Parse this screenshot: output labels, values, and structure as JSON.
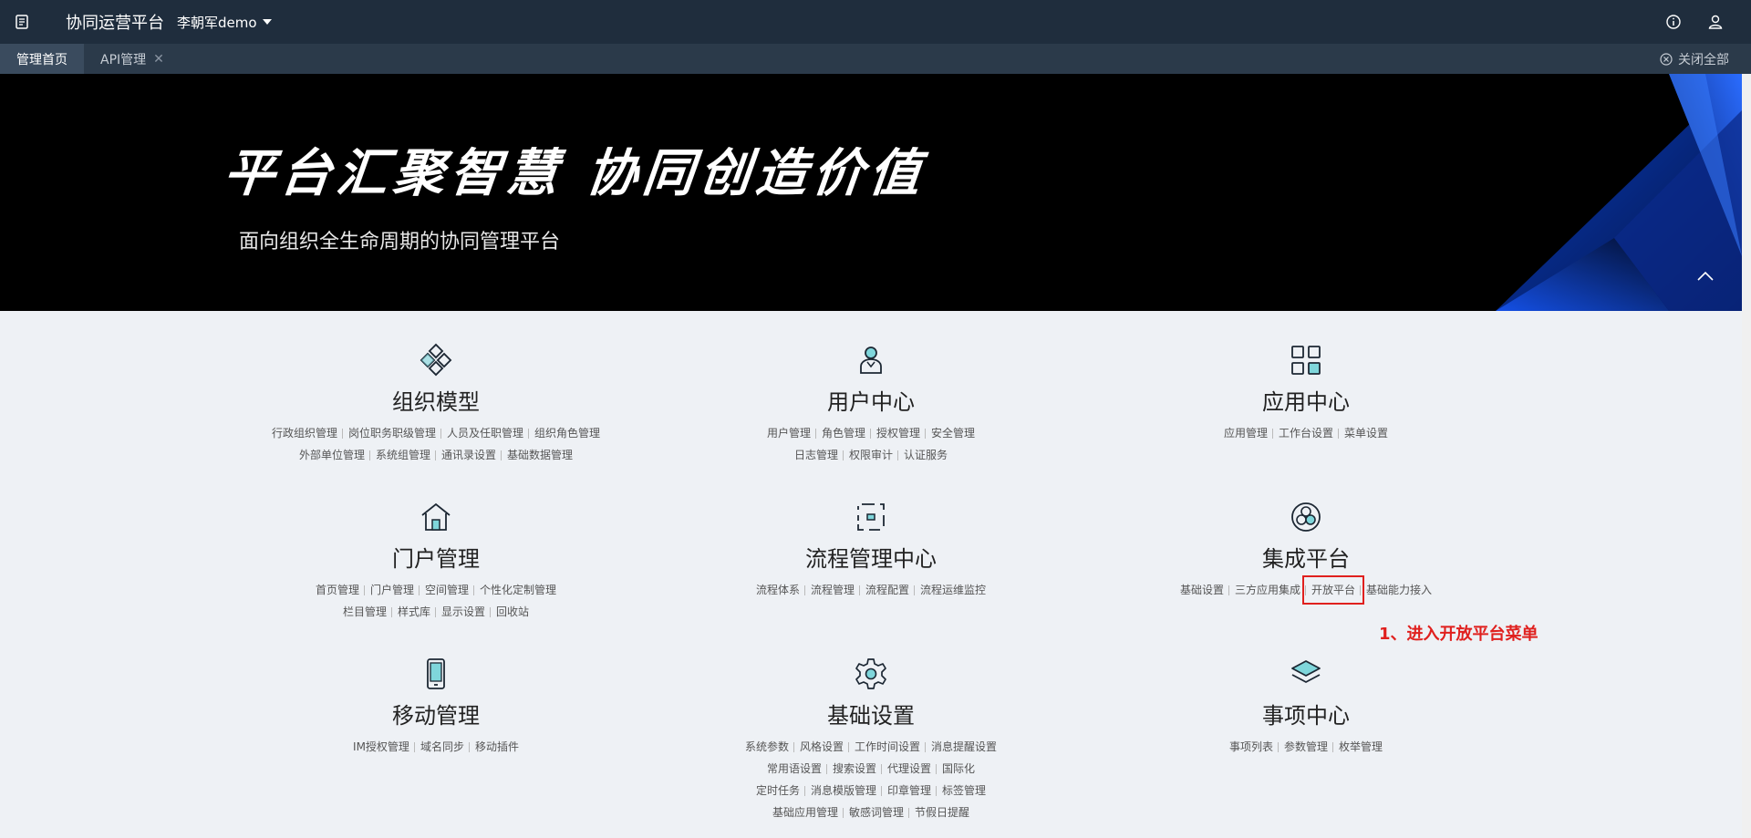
{
  "topbar": {
    "brand": "协同运营平台",
    "user": "李朝军demo"
  },
  "tabs": [
    {
      "label": "管理首页",
      "active": true
    },
    {
      "label": "API管理",
      "active": false
    }
  ],
  "close_all": "关闭全部",
  "banner": {
    "title": "平台汇聚智慧  协同创造价值",
    "subtitle": "面向组织全生命周期的协同管理平台"
  },
  "cards": [
    {
      "title": "组织模型",
      "icon": "org-model-icon",
      "link_rows": [
        [
          "行政组织管理",
          "岗位职务职级管理",
          "人员及任职管理",
          "组织角色管理"
        ],
        [
          "外部单位管理",
          "系统组管理",
          "通讯录设置",
          "基础数据管理"
        ]
      ]
    },
    {
      "title": "用户中心",
      "icon": "user-center-icon",
      "link_rows": [
        [
          "用户管理",
          "角色管理",
          "授权管理",
          "安全管理"
        ],
        [
          "日志管理",
          "权限审计",
          "认证服务"
        ]
      ]
    },
    {
      "title": "应用中心",
      "icon": "app-center-icon",
      "link_rows": [
        [
          "应用管理",
          "工作台设置",
          "菜单设置"
        ]
      ]
    },
    {
      "title": "门户管理",
      "icon": "portal-icon",
      "link_rows": [
        [
          "首页管理",
          "门户管理",
          "空间管理",
          "个性化定制管理"
        ],
        [
          "栏目管理",
          "样式库",
          "显示设置",
          "回收站"
        ]
      ]
    },
    {
      "title": "流程管理中心",
      "icon": "workflow-icon",
      "link_rows": [
        [
          "流程体系",
          "流程管理",
          "流程配置",
          "流程运维监控"
        ]
      ]
    },
    {
      "title": "集成平台",
      "icon": "integration-icon",
      "link_rows": [
        [
          "基础设置",
          "三方应用集成",
          "开放平台",
          "基础能力接入"
        ]
      ]
    },
    {
      "title": "移动管理",
      "icon": "mobile-icon",
      "link_rows": [
        [
          "IM授权管理",
          "域名同步",
          "移动插件"
        ]
      ]
    },
    {
      "title": "基础设置",
      "icon": "gear-icon",
      "link_rows": [
        [
          "系统参数",
          "风格设置",
          "工作时间设置",
          "消息提醒设置"
        ],
        [
          "常用语设置",
          "搜索设置",
          "代理设置",
          "国际化"
        ],
        [
          "定时任务",
          "消息模版管理",
          "印章管理",
          "标签管理"
        ],
        [
          "基础应用管理",
          "敏感词管理",
          "节假日提醒"
        ]
      ]
    },
    {
      "title": "事项中心",
      "icon": "layers-icon",
      "link_rows": [
        [
          "事项列表",
          "参数管理",
          "枚举管理"
        ]
      ]
    }
  ],
  "highlighted_link": "开放平台",
  "annotation": "1、进入开放平台菜单",
  "colors": {
    "topbar": "#1f2d3d",
    "tabbar": "#2b3a4a",
    "accent": "#00a6b4",
    "annotation": "#e0201e"
  }
}
